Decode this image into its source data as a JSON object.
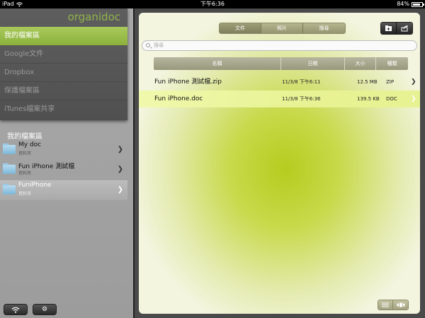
{
  "status_bar": {
    "device": "iPad",
    "time": "下午6:36",
    "battery": "84%",
    "battery_level": 0.84
  },
  "sidebar": {
    "logo": "organidoc",
    "menu": [
      {
        "label": "我的檔案區",
        "active": true
      },
      {
        "label": "Google文件",
        "active": false
      },
      {
        "label": "Dropbox",
        "active": false
      },
      {
        "label": "保護檔案區",
        "active": false
      },
      {
        "label": "iTunes檔案共享",
        "active": false
      }
    ],
    "section_title": "我的檔案區",
    "folders": [
      {
        "name": "My doc",
        "sub": "資料夾",
        "selected": false
      },
      {
        "name": "Fun iPhone 測試檔",
        "sub": "資料夾",
        "selected": false
      },
      {
        "name": "FuniPhone",
        "sub": "資料夾",
        "selected": true
      }
    ]
  },
  "main": {
    "segments": [
      {
        "label": "文件",
        "active": true
      },
      {
        "label": "照片",
        "active": false
      },
      {
        "label": "搜尋",
        "active": false
      }
    ],
    "search_placeholder": "搜尋",
    "columns": [
      "名稱",
      "日期",
      "大小",
      "種類"
    ],
    "files": [
      {
        "name": "Fun iPhone 測試檔.zip",
        "date": "11/3/8 下午6:11",
        "size": "12.5 MB",
        "type": "ZIP",
        "selected": false
      },
      {
        "name": "Fun iPhone.doc",
        "date": "11/3/8 下午6:36",
        "size": "139.5 KB",
        "type": "DOC",
        "selected": true
      }
    ]
  },
  "colors": {
    "accent": "#9cbf45",
    "panel_center": "#b6cc1f"
  }
}
